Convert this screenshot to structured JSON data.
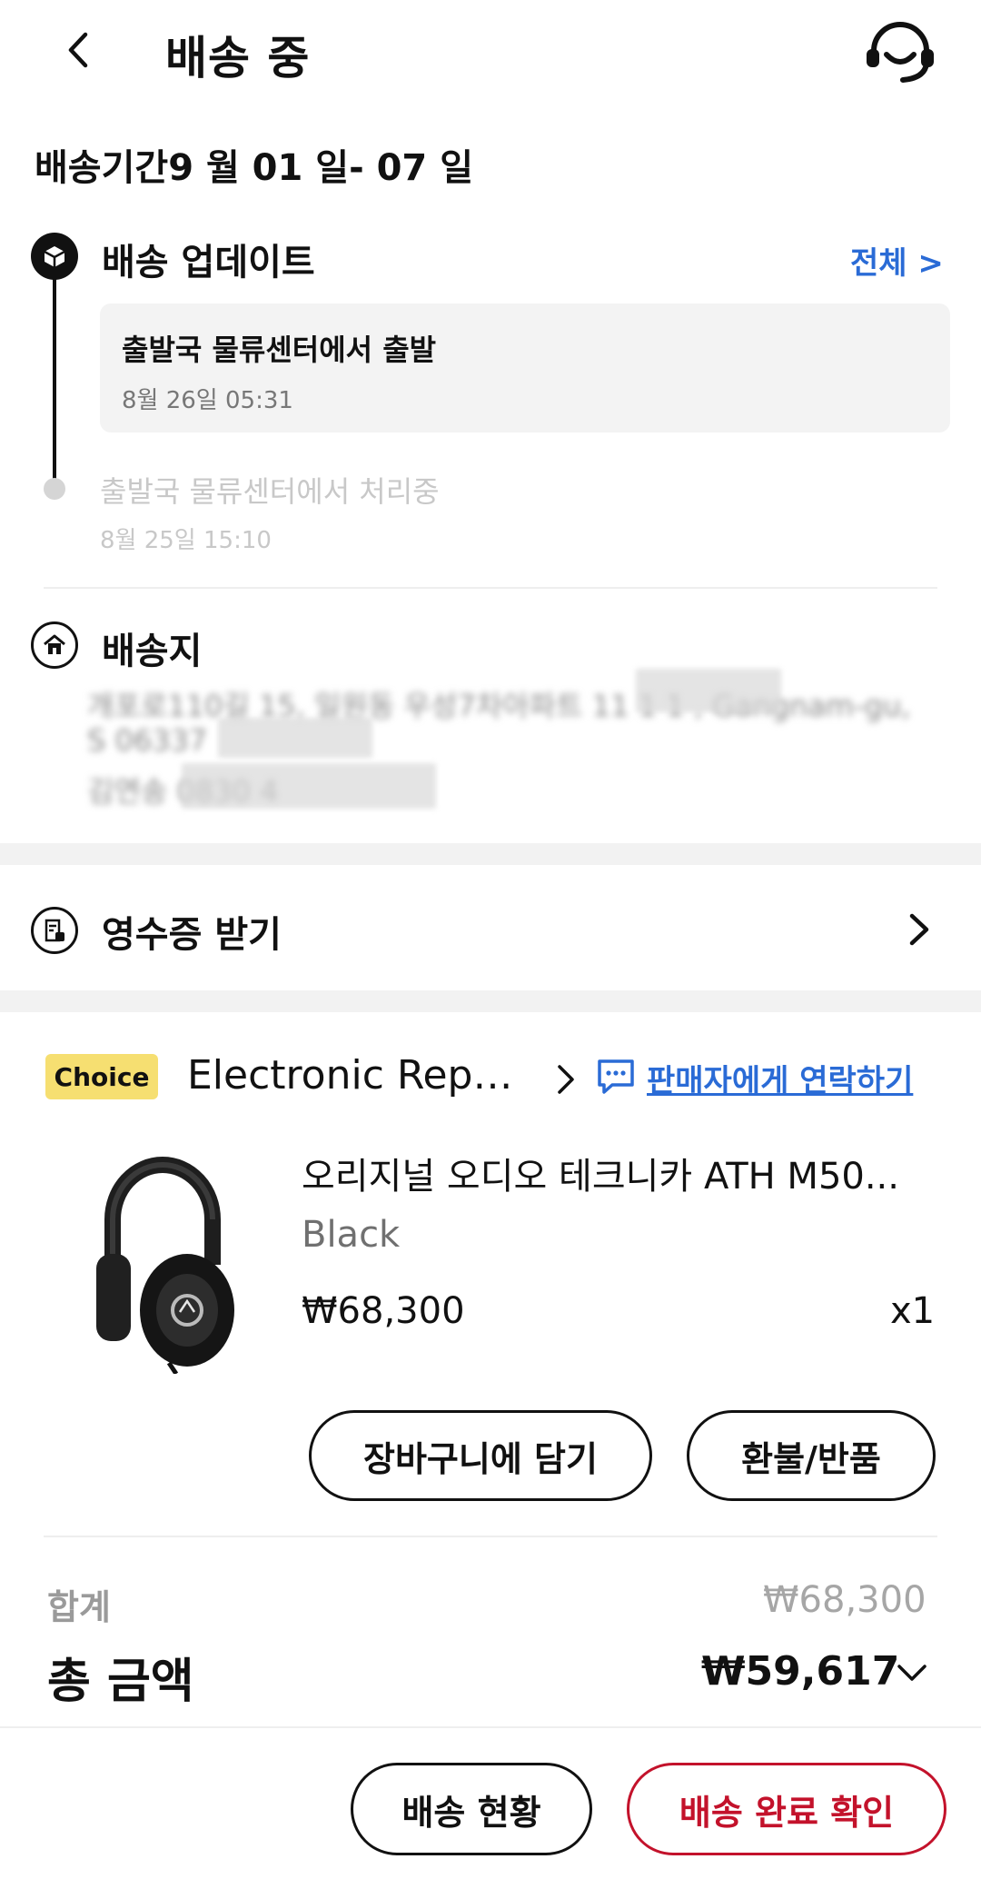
{
  "header": {
    "title": "배송 중",
    "back_icon": "chevron-left-icon",
    "support_icon": "headset-icon"
  },
  "delivery": {
    "period_label": "배송기간9 월 01 일- 07 일"
  },
  "updates": {
    "title": "배송 업데이트",
    "all_link": "전체 >",
    "latest": {
      "status": "출발국 물류센터에서 출발",
      "time": "8월 26일 05:31"
    },
    "previous": {
      "status": "출발국 물류센터에서 처리중",
      "time": "8월 25일 15:10"
    }
  },
  "address": {
    "title": "배송지",
    "line1": "개포로110길 15, 일원동 우성7차아파트 11 1 1 , Gangnam-gu,",
    "line2": "S 06337",
    "line3": "김연송 0830 4"
  },
  "receipt": {
    "label": "영수증 받기"
  },
  "seller": {
    "badge": "Choice",
    "name": "Electronic Reput...",
    "contact_link": "판매자에게 연락하기"
  },
  "product": {
    "name": "오리지널 오디오 테크니카 ATH M50...",
    "variant": "Black",
    "price": "₩68,300",
    "qty": "x1",
    "add_to_cart": "장바구니에 담기",
    "refund": "환불/반품"
  },
  "totals": {
    "subtotal_label": "합계",
    "subtotal_value": "₩68,300",
    "total_label": "총 금액",
    "total_value": "₩59,617"
  },
  "bottom": {
    "track_button": "배송 현황",
    "confirm_button": "배송 완료 확인"
  },
  "colors": {
    "link_blue": "#2a6bd6",
    "confirm_red": "#c3122b",
    "choice_yellow": "#f6df71"
  }
}
